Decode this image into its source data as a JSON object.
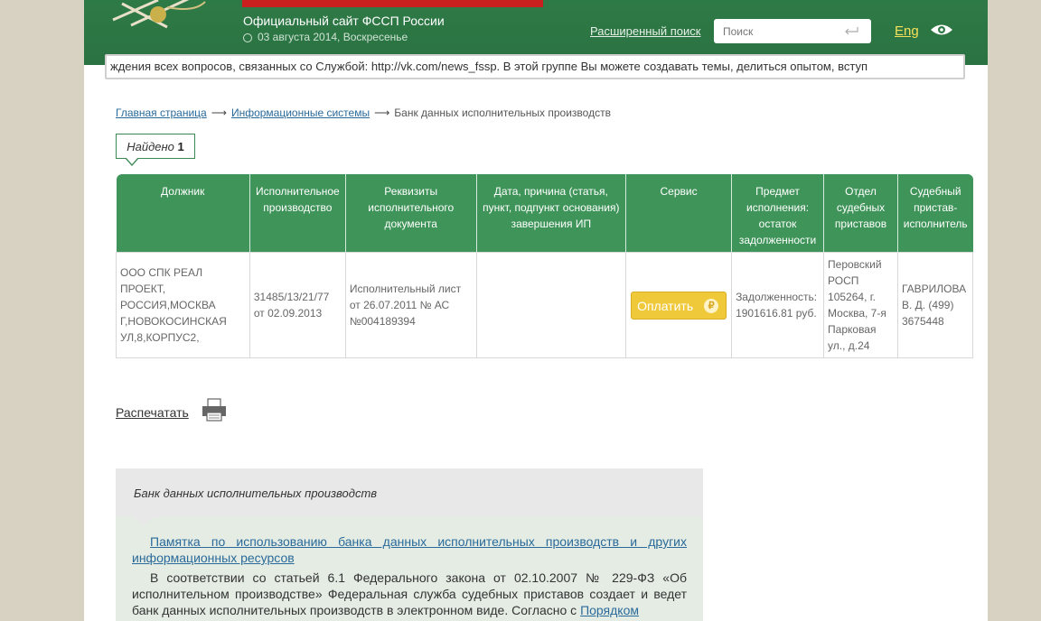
{
  "header": {
    "site_title": "Официальный сайт ФССП России",
    "date": "03 августа 2014, Воскресенье",
    "advanced_search": "Расширенный поиск",
    "search_placeholder": "Поиск",
    "lang": "Eng",
    "ticker": "ждения всех вопросов, связанных со Службой: http://vk.com/news_fssp. В этой группе Вы можете создавать темы, делиться опытом, вступ"
  },
  "breadcrumb": {
    "home": "Главная страница",
    "info_systems": "Информационные системы",
    "current": "Банк данных исполнительных производств",
    "separator": "⟶"
  },
  "found": {
    "label": "Найдено",
    "count": "1"
  },
  "table": {
    "headers": [
      "Должник",
      "Исполнительное производство",
      "Реквизиты исполнительного документа",
      "Дата, причина (статья, пункт, подпункт основания) завершения ИП",
      "Сервис",
      "Предмет исполнения: остаток задолженности",
      "Отдел судебных приставов",
      "Судебный пристав-исполнитель"
    ],
    "rows": [
      {
        "debtor": "ООО СПК РЕАЛ ПРОЕКТ, РОССИЯ,МОСКВА Г,НОВОКОСИНСКАЯ УЛ,8,КОРПУС2,",
        "proceeding": "31485/13/21/77 от 02.09.2013",
        "document": "Исполнительный лист от 26.07.2011 № АС №004189394",
        "completion": "",
        "service_button": "Оплатить",
        "service_icon": "₽",
        "subject": "Задолженность: 1901616.81 руб.",
        "department": "Перовский РОСП 105264, г. Москва, 7-я Парковая ул., д.24",
        "bailiff": "ГАВРИЛОВА В. Д. (499) 3675448"
      }
    ]
  },
  "print_label": "Распечатать",
  "info": {
    "title": "Банк данных исполнительных производств",
    "memo_link": "Памятка по использованию банка данных исполнительных производств и других информационных ресурсов",
    "body_text": "В соответствии со статьей 6.1 Федерального закона от 02.10.2007 № 229-ФЗ «Об исполнительном производстве» Федеральная служба судебных приставов создает и ведет банк данных исполнительных производств в электронном виде. Согласно с ",
    "body_link": "Порядком"
  },
  "colors": {
    "header_green": "#2e7a46",
    "table_header": "#3f9459",
    "pay_button": "#f0c93b",
    "lang_link": "#f4e15a"
  }
}
